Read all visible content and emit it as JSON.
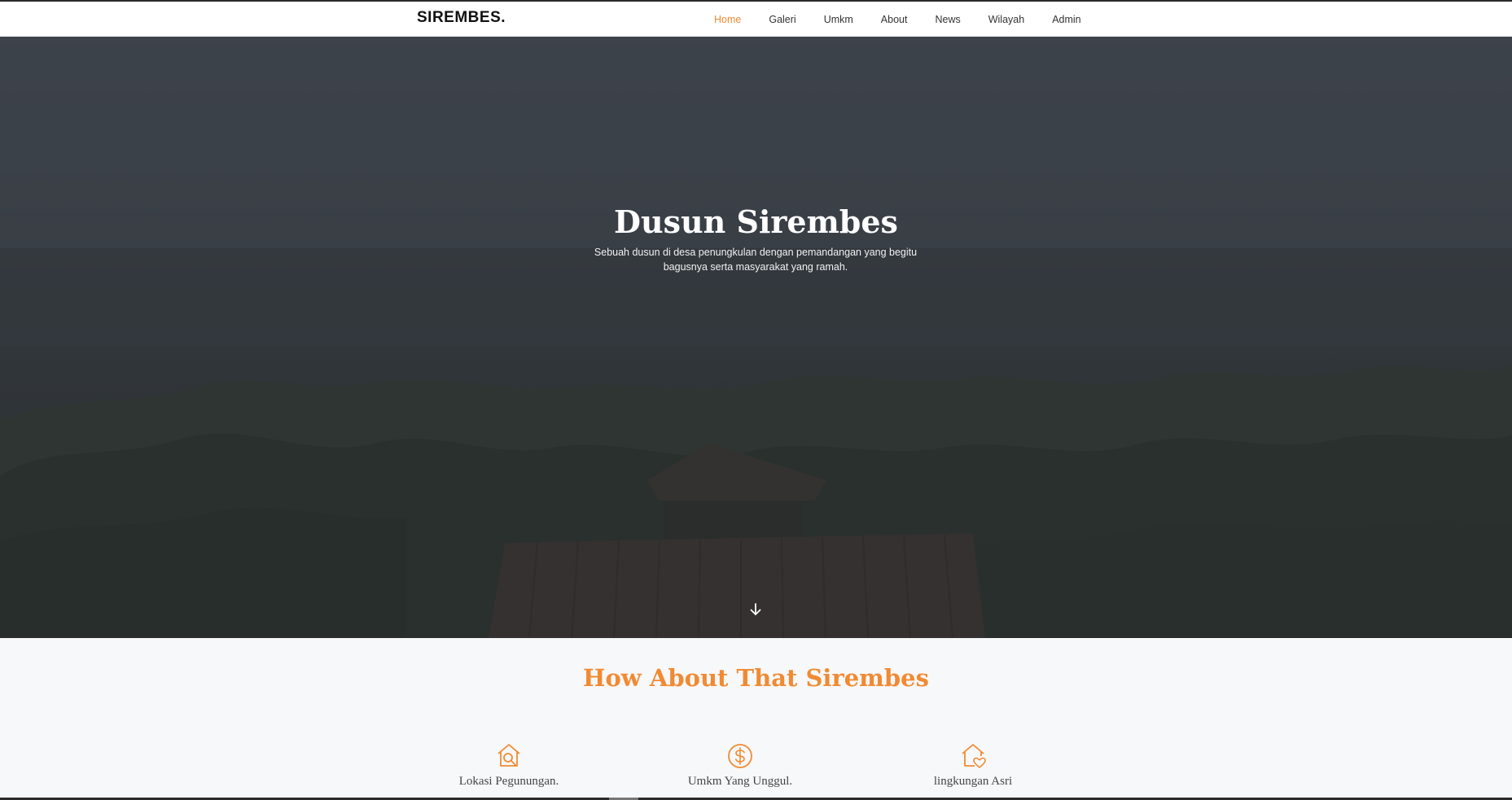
{
  "brand": {
    "name": "SIREMBES."
  },
  "nav": {
    "items": [
      {
        "label": "Home",
        "active": true
      },
      {
        "label": "Galeri",
        "active": false
      },
      {
        "label": "Umkm",
        "active": false
      },
      {
        "label": "About",
        "active": false
      },
      {
        "label": "News",
        "active": false
      },
      {
        "label": "Wilayah",
        "active": false
      },
      {
        "label": "Admin",
        "active": false
      }
    ]
  },
  "hero": {
    "title": "Dusun Sirembes",
    "subtitle": "Sebuah dusun di desa penungkulan dengan pemandangan yang begitu bagusnya serta masyarakat yang ramah.",
    "scroll_icon": "arrow-down-icon"
  },
  "about": {
    "title": "How About That Sirembes",
    "features": [
      {
        "label": "Lokasi Pegunungan.",
        "icon": "house-search-icon"
      },
      {
        "label": "Umkm Yang Unggul.",
        "icon": "dollar-coin-icon"
      },
      {
        "label": "lingkungan Asri",
        "icon": "house-heart-icon"
      }
    ]
  },
  "colors": {
    "accent": "#f18a32",
    "nav_bg": "#ffffff",
    "hero_overlay": "#3b4047",
    "section_bg": "#f7f8fa"
  }
}
